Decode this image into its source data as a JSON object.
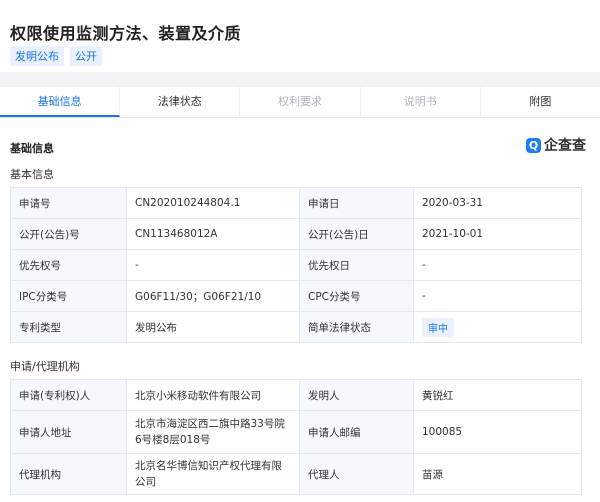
{
  "page": {
    "title": "权限使用监测方法、装置及介质",
    "badges": [
      "发明公布",
      "公开"
    ]
  },
  "tabs": [
    {
      "label": "基础信息",
      "state": "active"
    },
    {
      "label": "法律状态",
      "state": "normal"
    },
    {
      "label": "权利要求",
      "state": "disabled"
    },
    {
      "label": "说明书",
      "state": "disabled"
    },
    {
      "label": "附图",
      "state": "normal"
    }
  ],
  "section": {
    "title": "基础信息",
    "logo_mark": "Q",
    "logo_text": "企查查"
  },
  "basic_info": {
    "title": "基本信息",
    "rows": [
      [
        "申请号",
        "CN202010244804.1",
        "申请日",
        "2020-03-31"
      ],
      [
        "公开(公告)号",
        "CN113468012A",
        "公开(公告)日",
        "2021-10-01"
      ],
      [
        "优先权号",
        "-",
        "优先权日",
        "-"
      ],
      [
        "IPC分类号",
        "G06F11/30；G06F21/10",
        "CPC分类号",
        "-"
      ],
      [
        "专利类型",
        "发明公布",
        "简单法律状态",
        "审中"
      ]
    ]
  },
  "applicant": {
    "title": "申请/代理机构",
    "rows": [
      [
        "申请(专利权)人",
        "北京小米移动软件有限公司",
        "发明人",
        "黄锐红"
      ],
      [
        "申请人地址",
        "北京市海淀区西二旗中路33号院6号楼8层018号",
        "申请人邮编",
        "100085"
      ],
      [
        "代理机构",
        "北京名华博信知识产权代理有限公司",
        "代理人",
        "苗源"
      ]
    ]
  },
  "colors": {
    "accent": "#1a73e8",
    "key_bg": "#f5f8fc",
    "page_bg": "#f2f3f5"
  }
}
